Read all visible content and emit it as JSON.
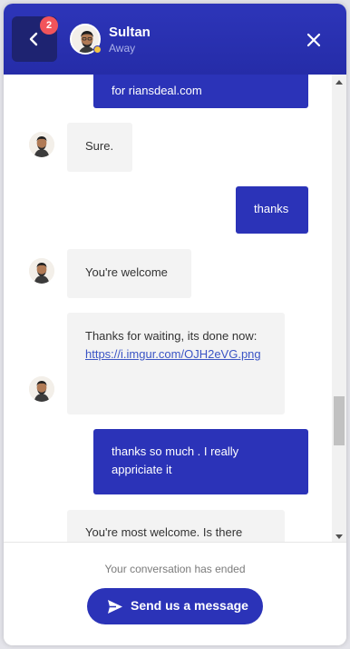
{
  "header": {
    "back_badge": "2",
    "agent_name": "Sultan",
    "agent_status": "Away"
  },
  "messages": [
    {
      "from": "user",
      "text": "for riansdeal.com"
    },
    {
      "from": "agent",
      "text": "Sure."
    },
    {
      "from": "user",
      "text": "thanks"
    },
    {
      "from": "agent",
      "text": "You're welcome"
    },
    {
      "from": "agent",
      "text": "Thanks for waiting, its done now:",
      "link": "https://i.imgur.com/OJH2eVG.png"
    },
    {
      "from": "user",
      "text": "thanks so much . I really appriciate it"
    },
    {
      "from": "agent",
      "text": "You're most welcome. Is there"
    }
  ],
  "footer": {
    "ended_text": "Your conversation has ended",
    "send_button_label": "Send us a message"
  },
  "colors": {
    "header": "#2b33b8",
    "user_bubble": "#2b33b8",
    "agent_bubble": "#f3f3f3",
    "badge": "#f2545b",
    "status_away": "#f5c542"
  },
  "icons": [
    "chevron-left-icon",
    "close-icon",
    "send-icon",
    "avatar"
  ]
}
